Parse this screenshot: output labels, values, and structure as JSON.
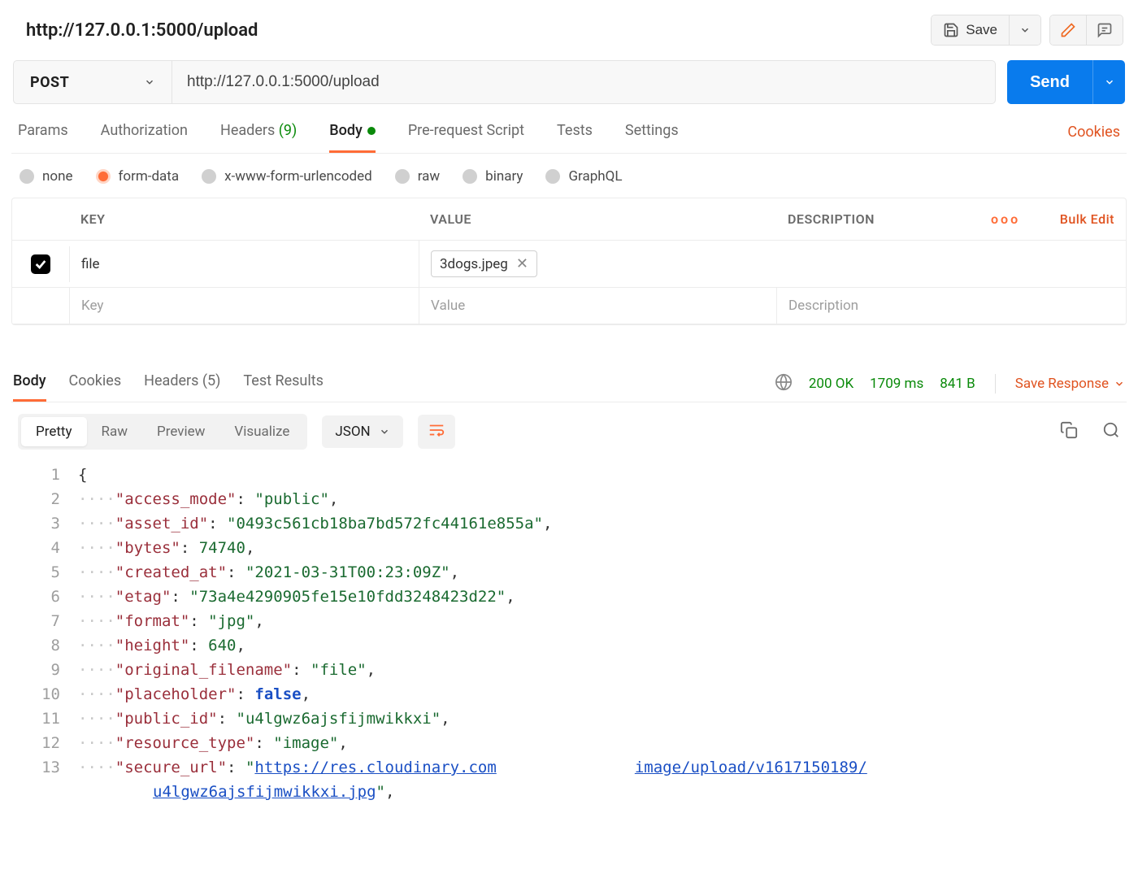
{
  "request": {
    "name": "http://127.0.0.1:5000/upload",
    "method": "POST",
    "url": "http://127.0.0.1:5000/upload",
    "save_label": "Save",
    "send_label": "Send"
  },
  "tabs": {
    "items": [
      {
        "label": "Params",
        "count": null,
        "active": false
      },
      {
        "label": "Authorization",
        "count": null,
        "active": false
      },
      {
        "label": "Headers",
        "count": "(9)",
        "active": false
      },
      {
        "label": "Body",
        "count": null,
        "active": true,
        "dot": true
      },
      {
        "label": "Pre-request Script",
        "count": null,
        "active": false
      },
      {
        "label": "Tests",
        "count": null,
        "active": false
      },
      {
        "label": "Settings",
        "count": null,
        "active": false
      }
    ],
    "cookies_label": "Cookies"
  },
  "body_types": [
    {
      "label": "none",
      "selected": false
    },
    {
      "label": "form-data",
      "selected": true
    },
    {
      "label": "x-www-form-urlencoded",
      "selected": false
    },
    {
      "label": "raw",
      "selected": false
    },
    {
      "label": "binary",
      "selected": false
    },
    {
      "label": "GraphQL",
      "selected": false
    }
  ],
  "kv_table": {
    "headers": {
      "key": "KEY",
      "value": "VALUE",
      "description": "DESCRIPTION",
      "bulk": "Bulk Edit",
      "more": "ooo"
    },
    "rows": [
      {
        "enabled": true,
        "key": "file",
        "value_file": "3dogs.jpeg",
        "description": ""
      }
    ],
    "placeholder": {
      "key": "Key",
      "value": "Value",
      "description": "Description"
    }
  },
  "response": {
    "tabs": [
      {
        "label": "Body",
        "count": null,
        "active": true
      },
      {
        "label": "Cookies",
        "count": null,
        "active": false
      },
      {
        "label": "Headers",
        "count": "(5)",
        "active": false
      },
      {
        "label": "Test Results",
        "count": null,
        "active": false
      }
    ],
    "status": "200 OK",
    "time": "1709 ms",
    "size": "841 B",
    "save_response_label": "Save Response"
  },
  "viewer": {
    "modes": [
      {
        "label": "Pretty",
        "active": true
      },
      {
        "label": "Raw",
        "active": false
      },
      {
        "label": "Preview",
        "active": false
      },
      {
        "label": "Visualize",
        "active": false
      }
    ],
    "format": "JSON"
  },
  "json_lines": [
    {
      "n": 1,
      "raw": "{"
    },
    {
      "n": 2,
      "key": "access_mode",
      "val": "public",
      "type": "str"
    },
    {
      "n": 3,
      "key": "asset_id",
      "val": "0493c561cb18ba7bd572fc44161e855a",
      "type": "str"
    },
    {
      "n": 4,
      "key": "bytes",
      "val": "74740",
      "type": "num"
    },
    {
      "n": 5,
      "key": "created_at",
      "val": "2021-03-31T00:23:09Z",
      "type": "str"
    },
    {
      "n": 6,
      "key": "etag",
      "val": "73a4e4290905fe15e10fdd3248423d22",
      "type": "str"
    },
    {
      "n": 7,
      "key": "format",
      "val": "jpg",
      "type": "str"
    },
    {
      "n": 8,
      "key": "height",
      "val": "640",
      "type": "num"
    },
    {
      "n": 9,
      "key": "original_filename",
      "val": "file",
      "type": "str"
    },
    {
      "n": 10,
      "key": "placeholder",
      "val": "false",
      "type": "bool"
    },
    {
      "n": 11,
      "key": "public_id",
      "val": "u4lgwz6ajsfijmwikkxi",
      "type": "str"
    },
    {
      "n": 12,
      "key": "resource_type",
      "val": "image",
      "type": "str"
    },
    {
      "n": 13,
      "key": "secure_url",
      "url_part1": "https://res.cloudinary.com",
      "url_gap": "image/upload/v1617150189/",
      "url_part2": "u4lgwz6ajsfijmwikkxi.jpg",
      "type": "url"
    }
  ]
}
